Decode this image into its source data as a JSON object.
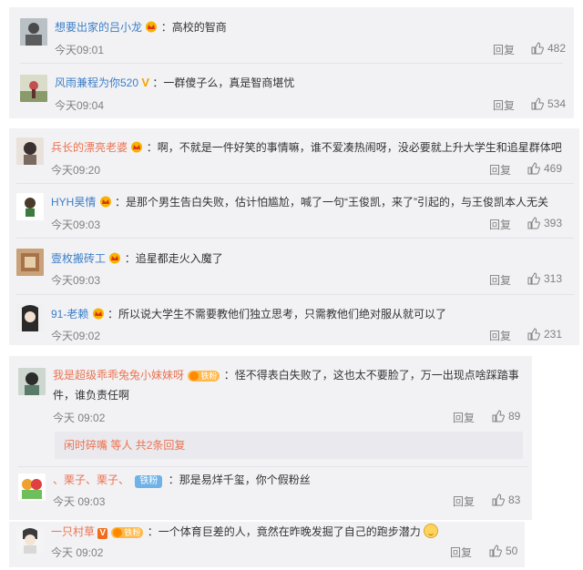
{
  "comments": [
    {
      "user": "想要出家的吕小龙",
      "text": "：高校的智商",
      "time": "今天09:01",
      "reply": "回复",
      "likes": "482"
    },
    {
      "user": "风雨兼程为你520",
      "text": "：一群傻子么，真是智商堪忧",
      "time": "今天09:04",
      "reply": "回复",
      "likes": "534"
    },
    {
      "user": "兵长的漂亮老婆",
      "text": "：啊，不就是一件好笑的事情嘛，谁不爱凑热闹呀，没必要就上升大学生和追星群体吧",
      "time": "今天09:20",
      "reply": "回复",
      "likes": "469"
    },
    {
      "user": "HYH昊情",
      "text": "：是那个男生告白失败，估计怕尴尬，喊了一句“王俊凯，来了”引起的，与王俊凯本人无关",
      "time": "今天09:03",
      "reply": "回复",
      "likes": "393"
    },
    {
      "user": "壹枚搬砖工",
      "text": "：追星都走火入魔了",
      "time": "今天09:03",
      "reply": "回复",
      "likes": "313"
    },
    {
      "user": "91-老赖",
      "text": "：所以说大学生不需要教他们独立思考，只需教他们绝对服从就可以了",
      "time": "今天09:02",
      "reply": "回复",
      "likes": "231"
    },
    {
      "user": "我是超级乖乖兔兔小妹妹呀",
      "badge": "铁粉",
      "text": "：怪不得表白失败了，这也太不要脸了，万一出现点啥踩踏事",
      "text2": "件，谁负责任啊",
      "time": "今天 09:02",
      "reply": "回复",
      "likes": "89"
    },
    {
      "sub_user": "闲时碎嘴",
      "sub_text": "等人 共2条回复"
    },
    {
      "user": "、栗子、栗子、",
      "badge": "铁粉",
      "text": "：那是易烊千玺，你个假粉丝",
      "time": "今天 09:03",
      "reply": "回复",
      "likes": "83"
    },
    {
      "user": "一只村草",
      "badge": "铁粉",
      "text": "：一个体育巨差的人，竟然在昨晚发掘了自己的跑步潜力",
      "time": "今天 09:02",
      "reply": "回复",
      "likes": "50"
    }
  ]
}
